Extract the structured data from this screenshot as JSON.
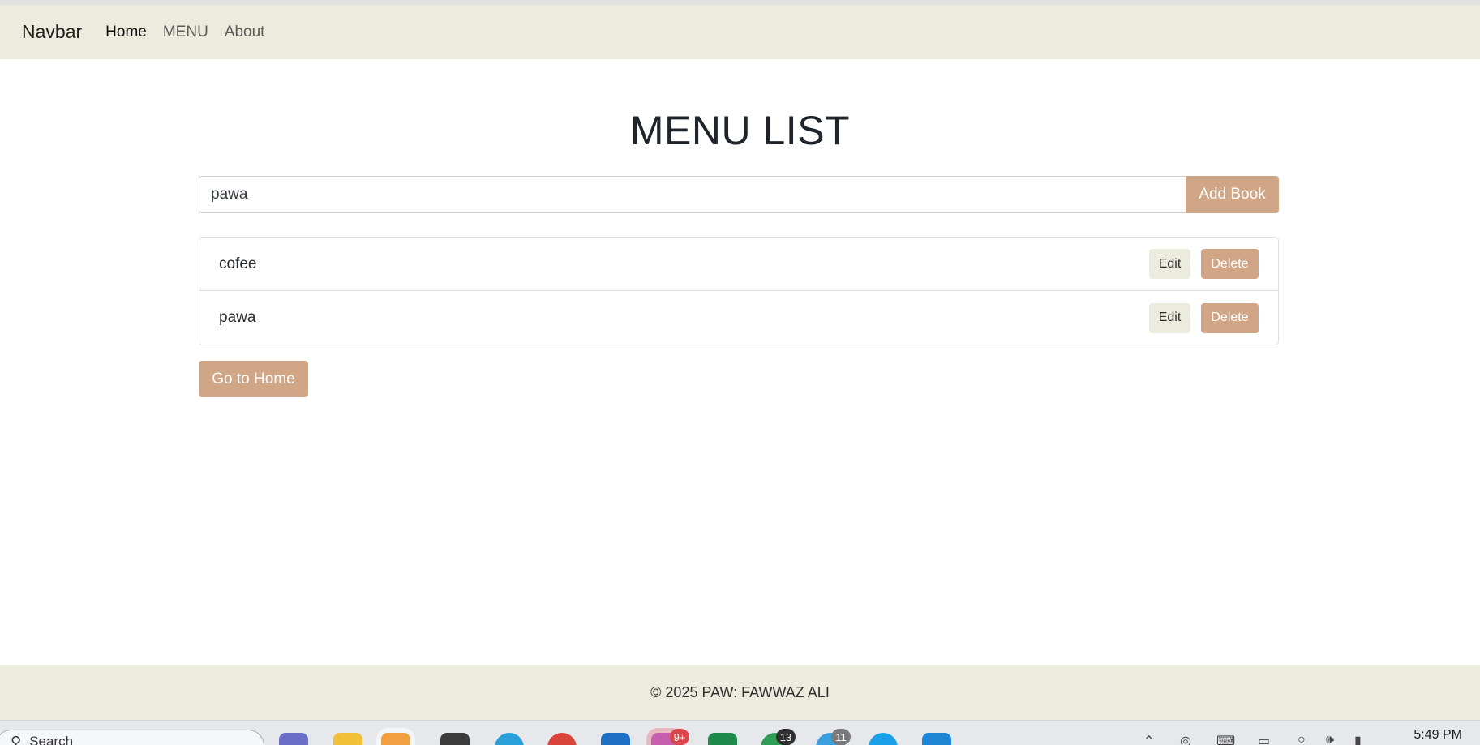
{
  "navbar": {
    "brand": "Navbar",
    "links": [
      {
        "label": "Home",
        "active": true
      },
      {
        "label": "MENU",
        "active": false
      },
      {
        "label": "About",
        "active": false
      }
    ]
  },
  "page": {
    "title": "MENU LIST",
    "input_value": "pawa",
    "add_button": "Add Book",
    "items": [
      {
        "name": "cofee",
        "edit": "Edit",
        "delete": "Delete"
      },
      {
        "name": "pawa",
        "edit": "Edit",
        "delete": "Delete"
      }
    ],
    "home_button": "Go to Home"
  },
  "footer": {
    "text": "© 2025 PAW: FAWWAZ ALI"
  },
  "taskbar": {
    "search_placeholder": "Search",
    "badges": {
      "mail": "9+",
      "whatsapp": "13",
      "telegram": "11"
    },
    "clock": "5:49 PM"
  },
  "colors": {
    "accent": "#d0a687",
    "navbar_bg": "#ebecde",
    "footer_bg": "#ebecde"
  }
}
